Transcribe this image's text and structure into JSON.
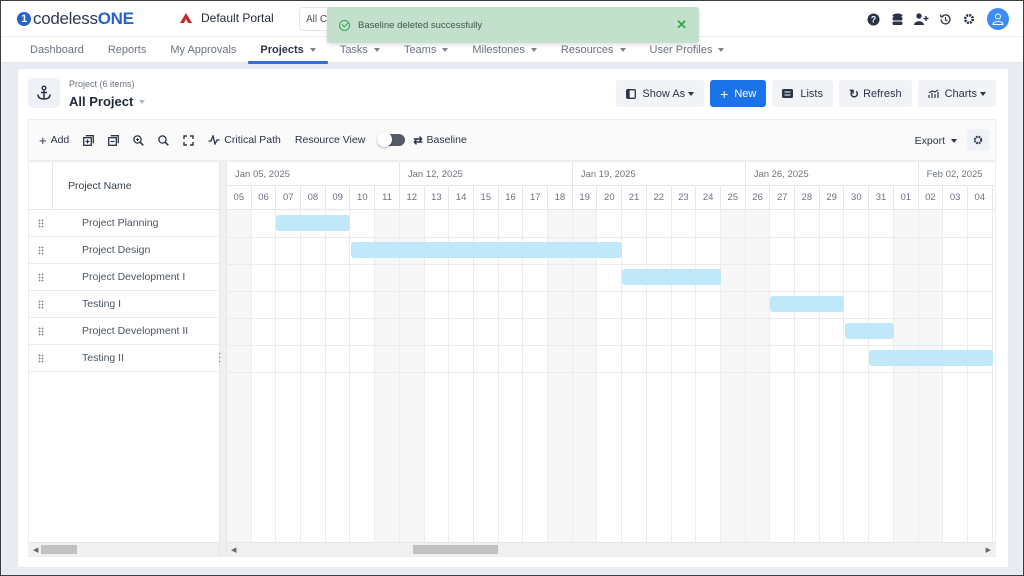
{
  "app": {
    "logo_prefix": "codeless",
    "logo_suffix": "ONE",
    "portal": "Default Portal",
    "scope_select": "All C"
  },
  "toast": {
    "message": "Baseline deleted successfully",
    "close": "✕",
    "color": "#c3e0cd"
  },
  "top_icons": [
    "help-icon",
    "database-icon",
    "add-user-icon",
    "history-icon",
    "gear-icon",
    "user-avatar"
  ],
  "nav": [
    {
      "label": "Dashboard",
      "dropdown": false,
      "active": false
    },
    {
      "label": "Reports",
      "dropdown": false,
      "active": false
    },
    {
      "label": "My Approvals",
      "dropdown": false,
      "active": false
    },
    {
      "label": "Projects",
      "dropdown": true,
      "active": true
    },
    {
      "label": "Tasks",
      "dropdown": true,
      "active": false
    },
    {
      "label": "Teams",
      "dropdown": true,
      "active": false
    },
    {
      "label": "Milestones",
      "dropdown": true,
      "active": false
    },
    {
      "label": "Resources",
      "dropdown": true,
      "active": false
    },
    {
      "label": "User Profiles",
      "dropdown": true,
      "active": false
    }
  ],
  "header": {
    "subtitle": "Project (6 items)",
    "title": "All Project"
  },
  "actions": {
    "show_as": "Show As",
    "new": "New",
    "lists": "Lists",
    "refresh": "Refresh",
    "charts": "Charts"
  },
  "toolbar": {
    "add": "Add",
    "critical_path": "Critical Path",
    "resource_view": "Resource View",
    "resource_view_on": false,
    "baseline": "Baseline",
    "export": "Export"
  },
  "grid": {
    "column_header": "Project Name",
    "rows": [
      "Project Planning",
      "Project Design",
      "Project Development I",
      "Testing I",
      "Project Development II",
      "Testing II"
    ]
  },
  "timeline": {
    "weeks": [
      "Jan 05, 2025",
      "Jan 12, 2025",
      "Jan 19, 2025",
      "Jan 26, 2025",
      "Feb 02, 2025"
    ],
    "days": [
      "05",
      "06",
      "07",
      "08",
      "09",
      "10",
      "11",
      "12",
      "13",
      "14",
      "15",
      "16",
      "17",
      "18",
      "19",
      "20",
      "21",
      "22",
      "23",
      "24",
      "25",
      "26",
      "27",
      "28",
      "29",
      "30",
      "31",
      "01",
      "02",
      "03",
      "04"
    ],
    "weekend_indices": [
      0,
      6,
      7,
      13,
      14,
      20,
      21,
      27,
      28
    ],
    "tasks": [
      {
        "name": "Project Planning",
        "start_index": 2,
        "end_index": 5
      },
      {
        "name": "Project Design",
        "start_index": 5,
        "end_index": 16
      },
      {
        "name": "Project Development I",
        "start_index": 16,
        "end_index": 20
      },
      {
        "name": "Testing I",
        "start_index": 22,
        "end_index": 25
      },
      {
        "name": "Project Development II",
        "start_index": 25,
        "end_index": 27
      },
      {
        "name": "Testing II",
        "start_index": 26,
        "end_index": 31
      }
    ],
    "bar_color": "#c0e8f9"
  }
}
